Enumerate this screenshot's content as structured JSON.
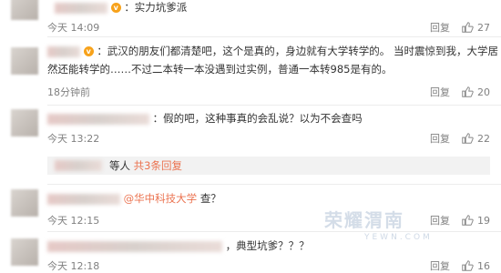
{
  "comments": [
    {
      "text": "：实力坑爹派",
      "time": "今天 14:09",
      "reply_label": "回复",
      "likes": "27"
    },
    {
      "line1": "：武汉的朋友们都清楚吧，这个是真的，身边就有大学转学的。 当时震惊到我，大学居",
      "line2": "然还能转学的……不过二本转一本没遇到过实例，普通一本转985是有的。",
      "time": "18分钟前",
      "reply_label": "回复",
      "likes": "20"
    },
    {
      "text": "：假的吧，这种事真的会乱说？以为不会查吗",
      "time": "今天 13:22",
      "reply_label": "回复",
      "likes": "22",
      "thread": {
        "prefix": "等人",
        "link": "共3条回复"
      }
    },
    {
      "mention": "@华中科技大学",
      "text": " 查？",
      "time": "今天 12:15",
      "reply_label": "回复",
      "likes": "19"
    },
    {
      "text": "，典型坑爹？？？",
      "time": "今天 12:18",
      "reply_label": "回复",
      "likes": "16"
    }
  ],
  "watermark": {
    "text": "荣耀渭南",
    "url": "YEWN.COM"
  },
  "icons": {
    "thumb": "thumbs-up-icon",
    "verified": "verified-badge-icon"
  },
  "colors": {
    "link": "#eb7350",
    "meta": "#808080"
  }
}
